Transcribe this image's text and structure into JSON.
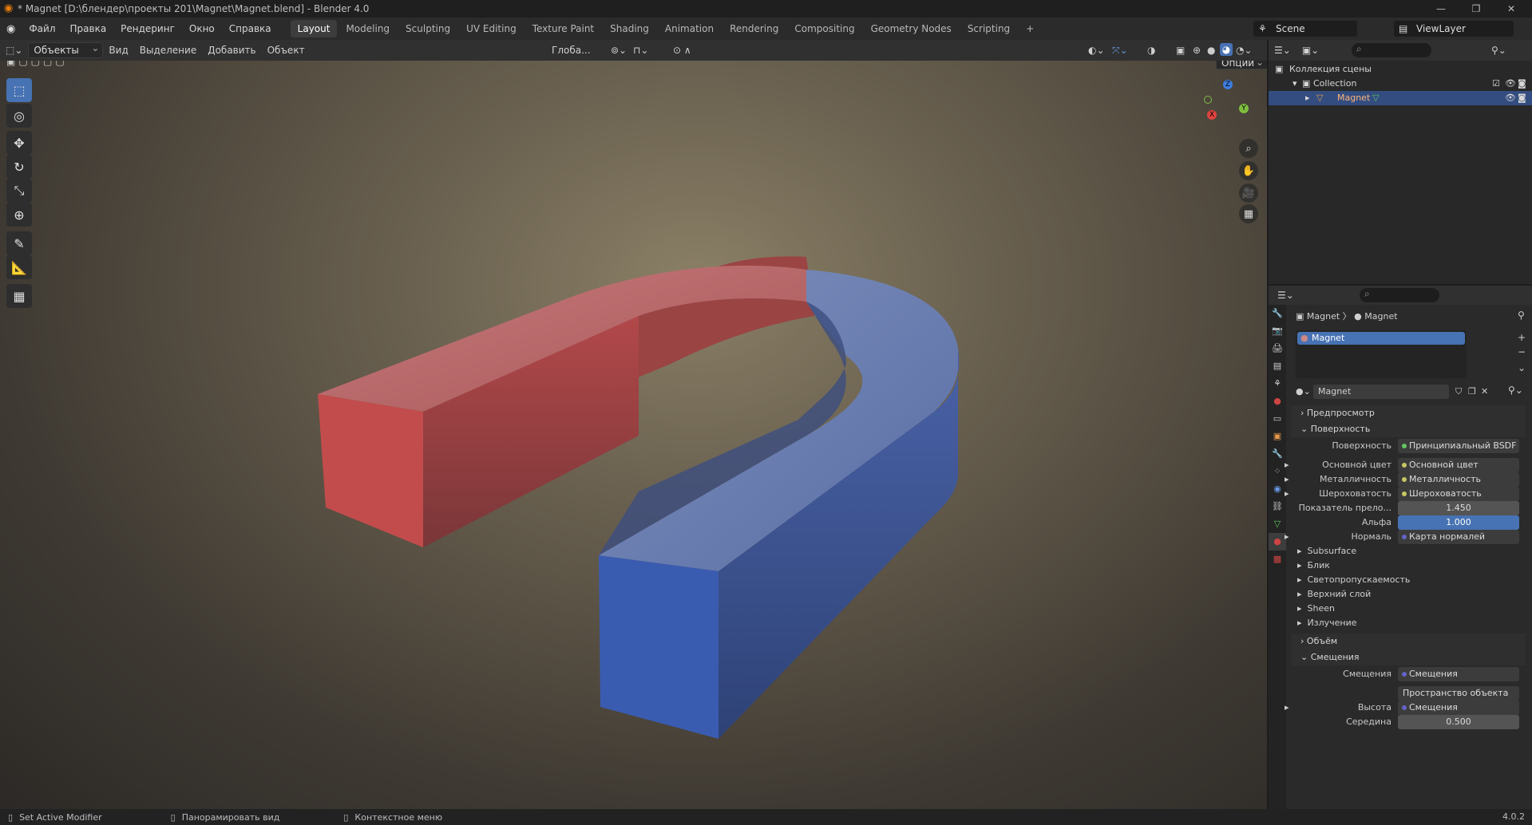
{
  "window": {
    "title": "* Magnet [D:\\блендер\\проекты 201\\Magnet\\Magnet.blend] - Blender 4.0",
    "min": "—",
    "max": "❐",
    "close": "✕"
  },
  "menu": [
    "Файл",
    "Правка",
    "Рендеринг",
    "Окно",
    "Справка"
  ],
  "workspaces": [
    "Layout",
    "Modeling",
    "Sculpting",
    "UV Editing",
    "Texture Paint",
    "Shading",
    "Animation",
    "Rendering",
    "Compositing",
    "Geometry Nodes",
    "Scripting"
  ],
  "workspace_add": "+",
  "scene": {
    "name": "Scene",
    "viewlayer": "ViewLayer"
  },
  "viewport_header": {
    "mode": "Объекты",
    "menus": [
      "Вид",
      "Выделение",
      "Добавить",
      "Объект"
    ],
    "orientation": "Глоба...",
    "options": "Опции"
  },
  "gizmo": {
    "x": "X",
    "y": "Y",
    "z": "Z"
  },
  "outliner": {
    "scene_collection": "Коллекция сцены",
    "collection": "Collection",
    "object": "Magnet"
  },
  "properties": {
    "breadcrumb_object": "Magnet",
    "breadcrumb_material": "Magnet",
    "slot": "Magnet",
    "material_name": "Magnet",
    "sections": {
      "preview": "Предпросмотр",
      "surface": "Поверхность",
      "volume": "Объём",
      "displacement": "Смещения"
    },
    "rows": [
      {
        "label": "Поверхность",
        "value": "Принципиальный BSDF",
        "kind": "node"
      },
      {
        "label": "Основной цвет",
        "value": "Основной цвет",
        "kind": "node"
      },
      {
        "label": "Металличность",
        "value": "Металличность",
        "kind": "node"
      },
      {
        "label": "Шероховатость",
        "value": "Шероховатость",
        "kind": "node"
      },
      {
        "label": "Показатель прело...",
        "value": "1.450",
        "kind": "num"
      },
      {
        "label": "Альфа",
        "value": "1.000",
        "kind": "blue"
      },
      {
        "label": "Нормаль",
        "value": "Карта нормалей",
        "kind": "node"
      }
    ],
    "subpanels": [
      "Subsurface",
      "Блик",
      "Светопропускаемость",
      "Верхний слой",
      "Sheen",
      "Излучение"
    ],
    "disp_rows": [
      {
        "label": "Смещения",
        "value": "Смещения"
      },
      {
        "label": "",
        "value": "Пространство объекта"
      },
      {
        "label": "Высота",
        "value": "Смещения"
      },
      {
        "label": "Середина",
        "value": "0.500"
      }
    ]
  },
  "statusbar": {
    "item1": "Set Active Modifier",
    "item2": "Панорамировать вид",
    "item3": "Контекстное меню",
    "version": "4.0.2"
  },
  "colors": {
    "accent": "#4772b3",
    "selection": "#334d80",
    "magnet_red": "#b8484a",
    "magnet_blue": "#3f5fa8"
  }
}
